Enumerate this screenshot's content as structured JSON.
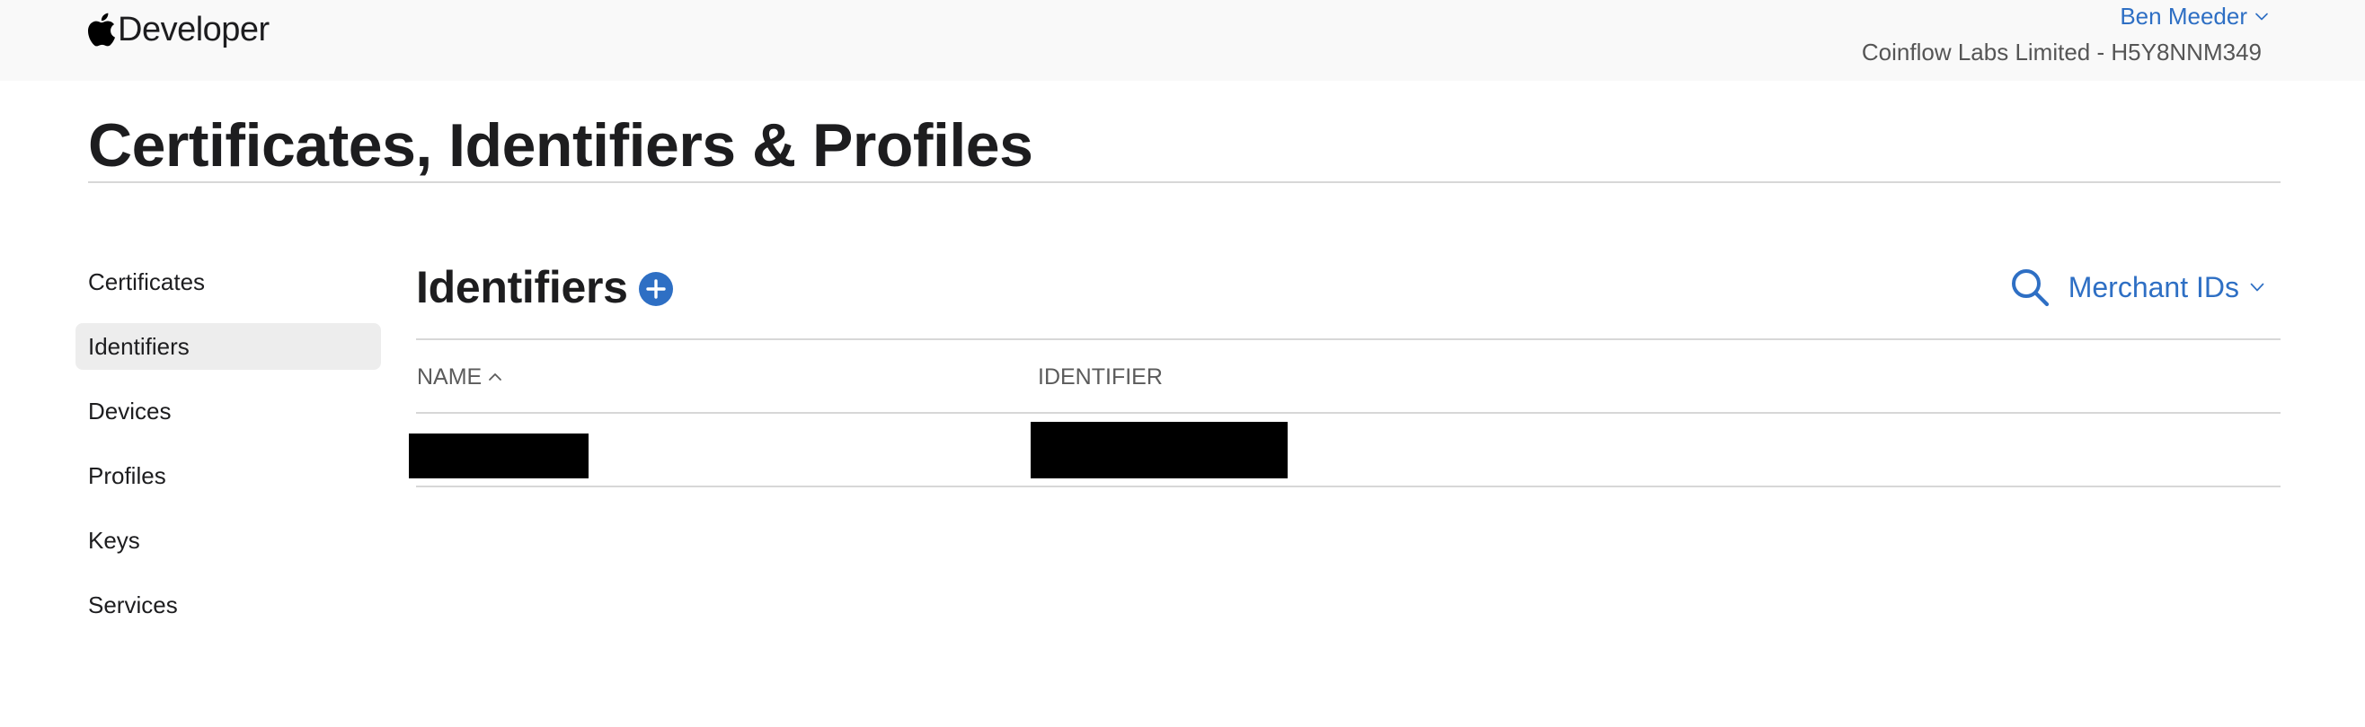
{
  "header": {
    "brand": "Developer",
    "logo_icon": "apple-logo-icon",
    "user_name": "Ben Meeder",
    "team_info": "Coinflow Labs Limited - H5Y8NNM349"
  },
  "page_title": "Certificates, Identifiers & Profiles",
  "sidebar": {
    "items": [
      {
        "label": "Certificates",
        "active": false
      },
      {
        "label": "Identifiers",
        "active": true
      },
      {
        "label": "Devices",
        "active": false
      },
      {
        "label": "Profiles",
        "active": false
      },
      {
        "label": "Keys",
        "active": false
      },
      {
        "label": "Services",
        "active": false
      }
    ]
  },
  "main": {
    "section_title": "Identifiers",
    "add_icon": "plus-circle-icon",
    "search_icon": "search-icon",
    "filter_label": "Merchant IDs",
    "table": {
      "columns": [
        "NAME",
        "IDENTIFIER"
      ],
      "sort_column": "NAME",
      "sort_direction": "ascending",
      "rows": [
        {
          "name": "",
          "identifier": "",
          "redacted": true
        }
      ]
    }
  },
  "colors": {
    "accent": "#2e6fc4",
    "header_bg": "#f9f9f9",
    "active_nav_bg": "#ededed",
    "divider": "#d7d7d7"
  }
}
